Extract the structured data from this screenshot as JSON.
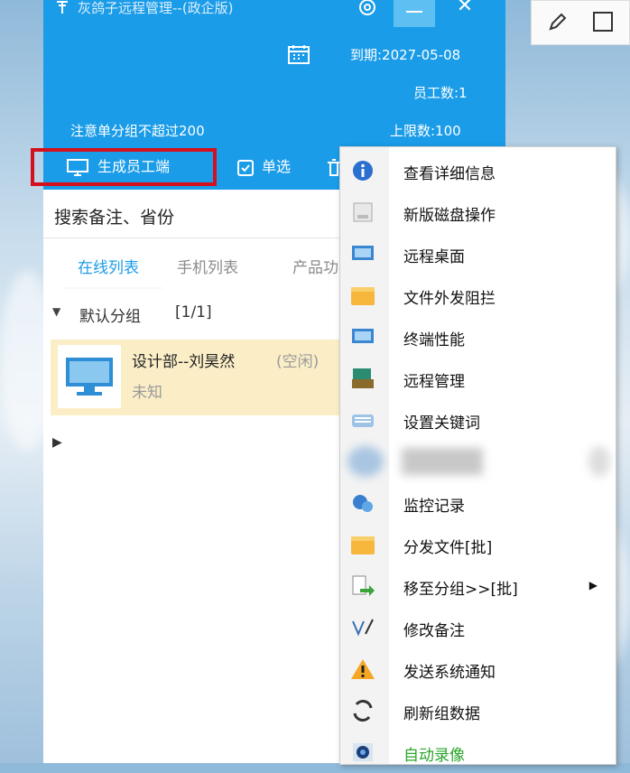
{
  "window": {
    "title": "灰鸽子远程管理--(政企版)",
    "expiry": "到期:2027-05-08",
    "employee_count": "员工数:1",
    "note": "注意单分组不超过200",
    "limit": "上限数:100"
  },
  "toolbar": {
    "generate_label": "生成员工端",
    "single_select_label": "单选"
  },
  "search": {
    "placeholder": "搜索备注、省份"
  },
  "tabs": [
    {
      "label": "在线列表",
      "active": true
    },
    {
      "label": "手机列表",
      "active": false
    },
    {
      "label": "产品功",
      "active": false
    }
  ],
  "group": {
    "name": "默认分组",
    "count": "[1/1]"
  },
  "device": {
    "name": "设计部--刘昊然",
    "status": "(空闲)",
    "sub": "未知"
  },
  "menu": {
    "items": [
      {
        "label": "查看详细信息",
        "icon": "info-icon"
      },
      {
        "label": "新版磁盘操作",
        "icon": "disk-icon"
      },
      {
        "label": "远程桌面",
        "icon": "monitor-icon"
      },
      {
        "label": "文件外发阻拦",
        "icon": "folder-icon"
      },
      {
        "label": "终端性能",
        "icon": "monitor-icon"
      },
      {
        "label": "远程管理",
        "icon": "computer-manage-icon"
      },
      {
        "label": "设置关键词",
        "icon": "keyboard-icon"
      },
      {
        "label": "",
        "icon": "blurred-icon"
      },
      {
        "label": "监控记录",
        "icon": "monitor-record-icon"
      },
      {
        "label": "分发文件[批]",
        "icon": "folder-icon"
      },
      {
        "label": "移至分组>>[批]",
        "icon": "move-file-icon"
      },
      {
        "label": "修改备注",
        "icon": "edit-note-icon"
      },
      {
        "label": "发送系统通知",
        "icon": "warning-icon"
      },
      {
        "label": "刷新组数据",
        "icon": "refresh-icon"
      },
      {
        "label": "自动录像",
        "icon": "camera-icon"
      }
    ]
  },
  "colors": {
    "accent": "#1a9ce8",
    "highlight": "#d4101c",
    "selected_row": "#fbeec7",
    "auto_record": "#2aa52a"
  }
}
